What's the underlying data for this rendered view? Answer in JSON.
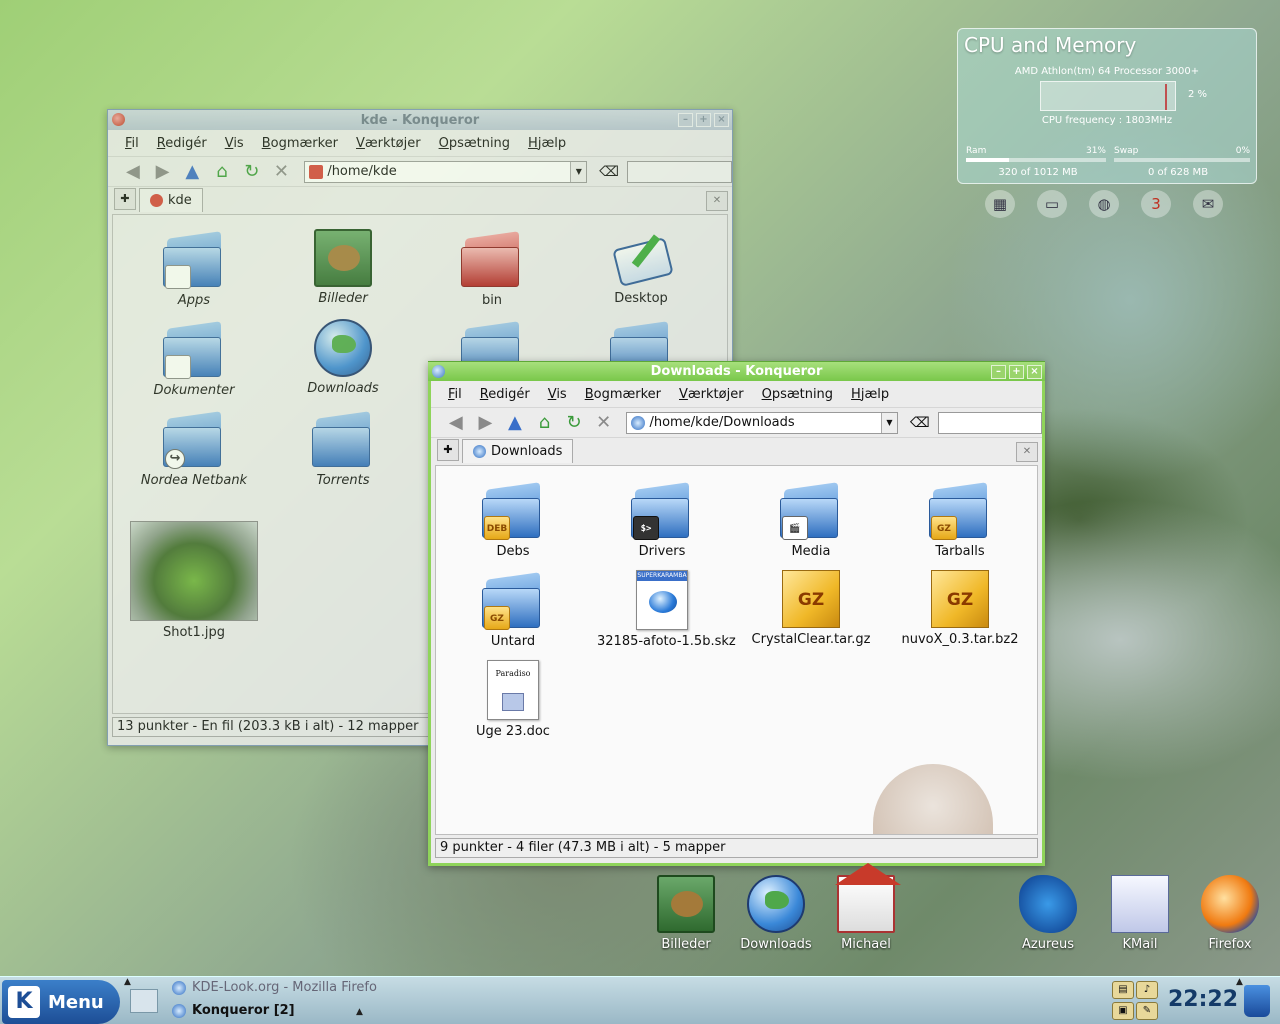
{
  "windows": {
    "kde": {
      "title": "kde - Konqueror",
      "menu": [
        "Fil",
        "Redigér",
        "Vis",
        "Bogmærker",
        "Værktøjer",
        "Opsætning",
        "Hjælp"
      ],
      "url": "/home/kde",
      "tab": "kde",
      "items": [
        "Apps",
        "Billeder",
        "bin",
        "Desktop",
        "Dokumenter",
        "Downloads",
        "Nordea Netbank",
        "Torrents",
        "Shot1.jpg"
      ],
      "status": "13 punkter - En fil (203.3 kB i alt) - 12 mapper"
    },
    "downloads": {
      "title": "Downloads - Konqueror",
      "menu": [
        "Fil",
        "Redigér",
        "Vis",
        "Bogmærker",
        "Værktøjer",
        "Opsætning",
        "Hjælp"
      ],
      "url": "/home/kde/Downloads",
      "tab": "Downloads",
      "items": [
        "Debs",
        "Drivers",
        "Media",
        "Tarballs",
        "Untard",
        "32185-afoto-1.5b.skz",
        "CrystalClear.tar.gz",
        "nuvoX_0.3.tar.bz2",
        "Uge 23.doc"
      ],
      "badges": {
        "deb": "DEB",
        "gz": "GZ",
        "term": "$>",
        "skz": "SUPERKARAMBA",
        "doc_title": "Paradiso"
      },
      "status": "9 punkter - 4 filer (47.3 MB i alt) - 5 mapper"
    }
  },
  "widget": {
    "title": "CPU and Memory",
    "processor": "AMD Athlon(tm) 64 Processor 3000+",
    "cpu_pct": "2 %",
    "frequency": "CPU frequency : 1803MHz",
    "ram_label": "Ram",
    "ram_pct": "31%",
    "ram_fraction": 0.31,
    "swap_label": "Swap",
    "swap_pct": "0%",
    "swap_fraction": 0,
    "ram_value": "320 of 1012 MB",
    "swap_value": "0 of 628 MB",
    "sys_icons": [
      "cpu-icon",
      "drive-icon",
      "network-icon",
      "calendar-icon",
      "mail-icon"
    ],
    "calendar_day": "3"
  },
  "desktop_icons": [
    "Billeder",
    "Downloads",
    "Michael",
    "Azureus",
    "KMail",
    "Firefox"
  ],
  "taskbar": {
    "menu_label": "Menu",
    "tasks": [
      "KDE-Look.org - Mozilla Firefo",
      "Konqueror [2]"
    ],
    "clock": "22:22"
  }
}
